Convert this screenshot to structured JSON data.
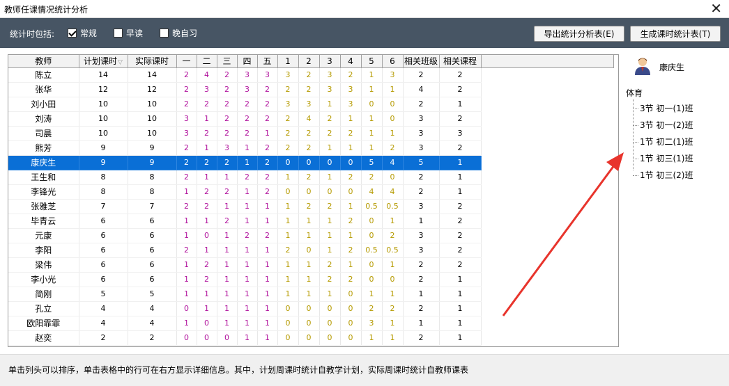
{
  "window": {
    "title": "教师任课情况统计分析",
    "close_glyph": "✕"
  },
  "toolbar": {
    "include_label": "统计时包括:",
    "options": [
      {
        "label": "常规",
        "checked": true
      },
      {
        "label": "早读",
        "checked": false
      },
      {
        "label": "晚自习",
        "checked": false
      }
    ],
    "export_button": "导出统计分析表(E)",
    "generate_button": "生成课时统计表(T)"
  },
  "table": {
    "columns": [
      "教师",
      "计划课时",
      "实际课时",
      "一",
      "二",
      "三",
      "四",
      "五",
      "1",
      "2",
      "3",
      "4",
      "5",
      "6",
      "相关班级",
      "相关课程"
    ],
    "sort_indicator": "▽",
    "colors": {
      "day": "#b1139d",
      "period": "#b59a00",
      "selected": "#0a6fd6"
    },
    "rows": [
      [
        "陈立",
        "14",
        "14",
        "2",
        "4",
        "2",
        "3",
        "3",
        "3",
        "2",
        "3",
        "2",
        "1",
        "3",
        "2",
        "2"
      ],
      [
        "张华",
        "12",
        "12",
        "2",
        "3",
        "2",
        "3",
        "2",
        "2",
        "2",
        "3",
        "3",
        "1",
        "1",
        "4",
        "2"
      ],
      [
        "刘小田",
        "10",
        "10",
        "2",
        "2",
        "2",
        "2",
        "2",
        "3",
        "3",
        "1",
        "3",
        "0",
        "0",
        "2",
        "1"
      ],
      [
        "刘涛",
        "10",
        "10",
        "3",
        "1",
        "2",
        "2",
        "2",
        "2",
        "4",
        "2",
        "1",
        "1",
        "0",
        "3",
        "2"
      ],
      [
        "司晨",
        "10",
        "10",
        "3",
        "2",
        "2",
        "2",
        "1",
        "2",
        "2",
        "2",
        "2",
        "1",
        "1",
        "3",
        "3"
      ],
      [
        "熊芳",
        "9",
        "9",
        "2",
        "1",
        "3",
        "1",
        "2",
        "2",
        "2",
        "1",
        "1",
        "1",
        "2",
        "3",
        "2"
      ],
      [
        "康庆生",
        "9",
        "9",
        "2",
        "2",
        "2",
        "1",
        "2",
        "0",
        "0",
        "0",
        "0",
        "5",
        "4",
        "5",
        "1"
      ],
      [
        "王生和",
        "8",
        "8",
        "2",
        "1",
        "1",
        "2",
        "2",
        "1",
        "2",
        "1",
        "2",
        "2",
        "0",
        "2",
        "1"
      ],
      [
        "李锋光",
        "8",
        "8",
        "1",
        "2",
        "2",
        "1",
        "2",
        "0",
        "0",
        "0",
        "0",
        "4",
        "4",
        "2",
        "1"
      ],
      [
        "张雅芝",
        "7",
        "7",
        "2",
        "2",
        "1",
        "1",
        "1",
        "1",
        "2",
        "2",
        "1",
        "0.5",
        "0.5",
        "3",
        "2"
      ],
      [
        "毕青云",
        "6",
        "6",
        "1",
        "1",
        "2",
        "1",
        "1",
        "1",
        "1",
        "1",
        "2",
        "0",
        "1",
        "1",
        "2"
      ],
      [
        "元康",
        "6",
        "6",
        "1",
        "0",
        "1",
        "2",
        "2",
        "1",
        "1",
        "1",
        "1",
        "0",
        "2",
        "3",
        "2"
      ],
      [
        "李阳",
        "6",
        "6",
        "2",
        "1",
        "1",
        "1",
        "1",
        "2",
        "0",
        "1",
        "2",
        "0.5",
        "0.5",
        "3",
        "2"
      ],
      [
        "梁伟",
        "6",
        "6",
        "1",
        "2",
        "1",
        "1",
        "1",
        "1",
        "1",
        "2",
        "1",
        "0",
        "1",
        "2",
        "2"
      ],
      [
        "李小光",
        "6",
        "6",
        "1",
        "2",
        "1",
        "1",
        "1",
        "1",
        "1",
        "2",
        "2",
        "0",
        "0",
        "2",
        "1"
      ],
      [
        "简刚",
        "5",
        "5",
        "1",
        "1",
        "1",
        "1",
        "1",
        "1",
        "1",
        "1",
        "0",
        "1",
        "1",
        "1",
        "1"
      ],
      [
        "孔立",
        "4",
        "4",
        "0",
        "1",
        "1",
        "1",
        "1",
        "0",
        "0",
        "0",
        "0",
        "2",
        "2",
        "2",
        "1"
      ],
      [
        "欧阳霏霏",
        "4",
        "4",
        "1",
        "0",
        "1",
        "1",
        "1",
        "0",
        "0",
        "0",
        "0",
        "3",
        "1",
        "1",
        "1"
      ],
      [
        "赵奕",
        "2",
        "2",
        "0",
        "0",
        "0",
        "1",
        "1",
        "0",
        "0",
        "0",
        "0",
        "1",
        "1",
        "2",
        "1"
      ]
    ],
    "selected_row": 6
  },
  "detail": {
    "teacher_name": "康庆生",
    "avatar_icon": "user-avatar-icon",
    "subject": "体育",
    "classes": [
      "3节 初一(1)班",
      "3节 初一(2)班",
      "1节 初二(1)班",
      "1节 初三(1)班",
      "1节 初三(2)班"
    ]
  },
  "status_text": "单击列头可以排序，单击表格中的行可在右方显示详细信息。其中，计划周课时统计自教学计划，实际周课时统计自教师课表"
}
